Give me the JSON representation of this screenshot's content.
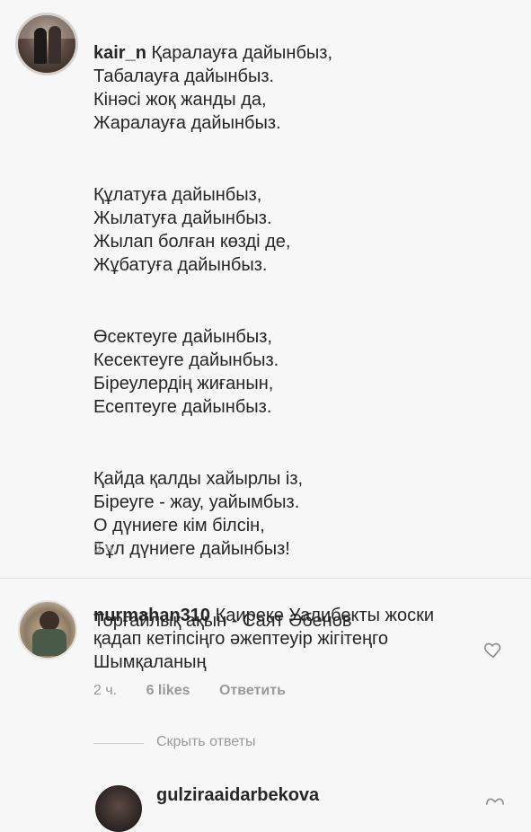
{
  "post": {
    "username": "kair_n",
    "stanzas": [
      "Қаралауға дайынбыз,\nТабалауға дайынбыз.\nКінәсі жоқ жанды да,\nЖаралауға дайынбыз.",
      "Құлатуға дайынбыз,\nЖылатуға дайынбыз.\nЖылап болған көзді де,\nЖұбатуға дайынбыз.",
      "Өсектеуге дайынбыз,\nКесектеуге дайынбыз.\nБіреулердің жиғанын,\nЕсептеуге дайынбыз.",
      "Қайда қалды хайырлы із,\nБіреуге - жау, уайымбыз.\nО дүниеге кім білсін,\nБұл дүниеге дайынбыз!"
    ],
    "credit": "Торғайлық ақын - Саят Әбенов",
    "time": "3 ч."
  },
  "comment": {
    "username": "nurmahan310",
    "text": "Қаиреке Уалибекты жоски қадап кетіпсіңго әжептеуір жігітеңго Шымқаланың",
    "time": "2 ч.",
    "likes": "6 likes",
    "reply": "Ответить"
  },
  "replies_toggle": "Скрыть ответы",
  "next_comment": {
    "username": "gulziraaidarbekova"
  },
  "icons": {
    "like": "heart-outline-icon"
  },
  "colors": {
    "background": "#f7f7f7",
    "text": "#262626",
    "muted": "#9a9a9a"
  }
}
